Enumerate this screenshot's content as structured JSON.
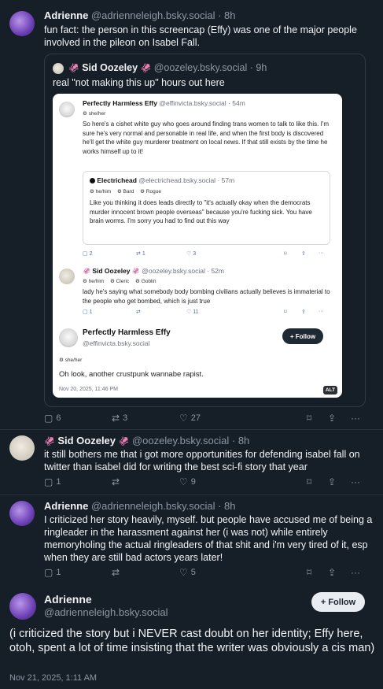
{
  "post1": {
    "author_name": "Adrienne",
    "author_handle": "@adrienneleigh.bsky.social",
    "time": "8h",
    "text": "fun fact: the person in this screencap (Effy) was one of the major people involved in the pileon on Isabel Fall.",
    "quote": {
      "author_name": "Sid Oozeley",
      "emoji": "🦑",
      "author_handle": "@oozeley.bsky.social",
      "time": "9h",
      "text": "real \"not making this up\" hours out here",
      "screenshot": {
        "post_a": {
          "name": "Perfectly Harmless Effy",
          "handle": "@effinvicta.bsky.social",
          "time": "54m",
          "badge": "she/her",
          "text": "So here's a cishet white guy who goes around finding trans women to talk to like this. I'm sure he's very normal and personable in real life, and when the first body is discovered he'll get the white guy murderer treatment on local news. If that still exists by the time he works himself up to it!",
          "inner": {
            "name": "Electrichead",
            "handle": "@electrichead.bsky.social",
            "time": "57m",
            "badges": [
              "he/him",
              "Bard",
              "Rogue"
            ],
            "text": "Like you thinking it does leads directly to \"it's actually okay when the democrats murder innocent brown people overseas\" because you're fucking sick. You have brain worms. I'm sorry you had to find out this way"
          },
          "replies": "2",
          "reposts": "1",
          "likes": "3"
        },
        "post_b": {
          "name": "Sid Oozeley",
          "handle": "@oozeley.bsky.social",
          "time": "52m",
          "badges": [
            "he/him",
            "Cleric",
            "Goblin"
          ],
          "text": "lady he's saying what somebody body bombing civilians actually believes is immaterial to the people who get bombed, which is just true",
          "replies": "1",
          "reposts": "",
          "likes": "11"
        },
        "post_c": {
          "name": "Perfectly Harmless Effy",
          "handle": "@effinvicta.bsky.social",
          "badge": "she/her",
          "follow": "+ Follow",
          "text": "Oh look, another crustpunk wannabe rapist.",
          "date": "Nov 20, 2025, 11:46 PM",
          "alt": "ALT"
        }
      }
    },
    "replies": "6",
    "reposts": "3",
    "likes": "27"
  },
  "post2": {
    "author_name": "Sid Oozeley",
    "emoji": "🦑",
    "author_handle": "@oozeley.bsky.social",
    "time": "8h",
    "text": "it still bothers me that i got more opportunities for defending isabel fall on twitter than isabel did for writing the best sci-fi story that year",
    "replies": "1",
    "reposts": "",
    "likes": "9"
  },
  "post3": {
    "author_name": "Adrienne",
    "author_handle": "@adrienneleigh.bsky.social",
    "time": "8h",
    "text": "I criticized her story heavily, myself. but people have accused me of being a ringleader in the harassment against her (i was not) while entirely memoryholing the actual ringleaders of that shit and i'm very tired of it, esp when they are still bad actors years later!",
    "replies": "1",
    "reposts": "",
    "likes": "5"
  },
  "post4": {
    "author_name": "Adrienne",
    "author_handle": "@adrienneleigh.bsky.social",
    "follow": "+ Follow",
    "text": "(i criticized the story but i NEVER cast doubt on her identity; Effy here, otoh, spent a lot of time insisting that the writer was obviously a cis man)",
    "date": "Nov 21, 2025, 1:11 AM"
  },
  "icons": {
    "reply": "reply-icon",
    "repost": "repost-icon",
    "like": "heart-icon",
    "bookmark": "bookmark-icon",
    "share": "share-icon",
    "more": "more-icon"
  }
}
